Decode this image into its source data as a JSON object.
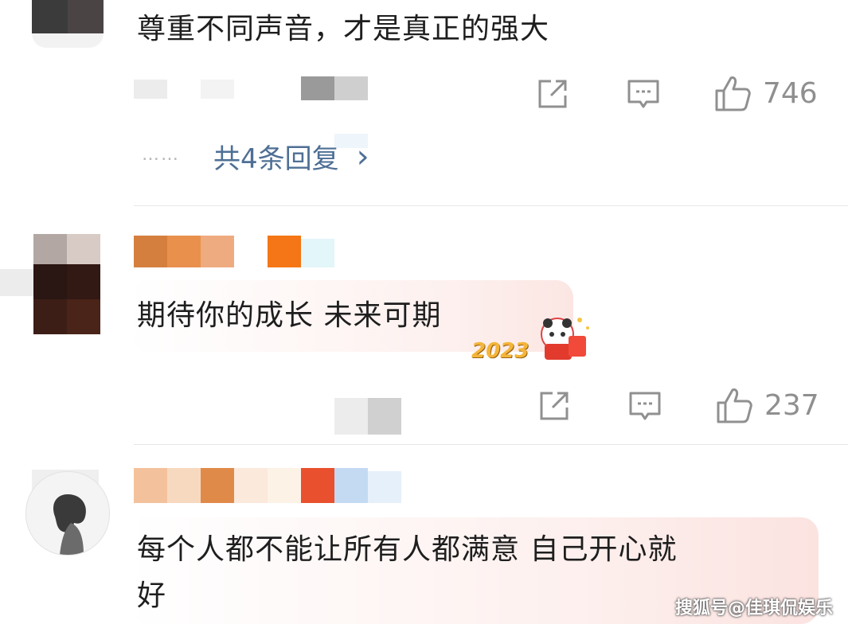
{
  "comments": [
    {
      "text": "尊重不同声音，才是真正的强大",
      "like_count": "746",
      "replies_label": "共4条回复",
      "replies_chevron": "›",
      "ellipsis": "……"
    },
    {
      "text": "期待你的成长 未来可期",
      "like_count": "237",
      "sticker": "2023"
    },
    {
      "text_line1": "每个人都不能让所有人都满意 自己开心就",
      "text_line2": "好"
    }
  ],
  "icons": {
    "share": "share-icon",
    "comment": "comment-icon",
    "like": "thumbs-up-icon"
  },
  "watermark": "搜狐号@佳琪侃娱乐",
  "colors": {
    "reply_link": "#4e6f95",
    "count_gray": "#8f8f8f",
    "bubble_pink": "#fdeceb"
  }
}
